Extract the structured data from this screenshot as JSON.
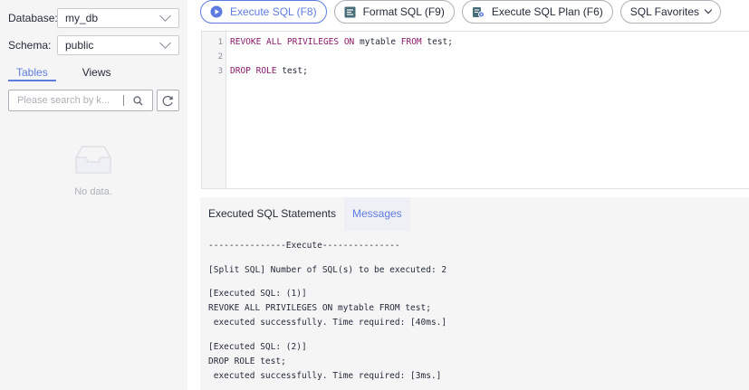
{
  "sidebar": {
    "database_label": "Database:",
    "database_value": "my_db",
    "schema_label": "Schema:",
    "schema_value": "public",
    "tabs": [
      {
        "label": "Tables",
        "active": true
      },
      {
        "label": "Views",
        "active": false
      }
    ],
    "search_placeholder": "Please search by k...",
    "empty_text": "No data."
  },
  "toolbar": {
    "execute_label": "Execute SQL (F8)",
    "format_label": "Format SQL (F9)",
    "plan_label": "Execute SQL Plan (F6)",
    "favorites_label": "SQL Favorites"
  },
  "editor": {
    "line_numbers": [
      "1",
      "2",
      "3"
    ],
    "line1": [
      {
        "text": "REVOKE ALL PRIVILEGES ON",
        "keyword": true
      },
      {
        "text": " mytable ",
        "keyword": false
      },
      {
        "text": "FROM",
        "keyword": true
      },
      {
        "text": " test;",
        "keyword": false
      }
    ],
    "line3": [
      {
        "text": "DROP ROLE",
        "keyword": true
      },
      {
        "text": " test;",
        "keyword": false
      }
    ]
  },
  "results": {
    "tabs": [
      {
        "label": "Executed SQL Statements",
        "active": false
      },
      {
        "label": "Messages",
        "active": true
      }
    ],
    "messages": {
      "header": "---------------Execute---------------",
      "split": "[Split SQL] Number of SQL(s) to be executed: 2",
      "exec1_title": "[Executed SQL: (1)]",
      "exec1_sql": "REVOKE ALL PRIVILEGES ON mytable FROM test;",
      "exec1_result": " executed successfully. Time required: [40ms.]",
      "exec2_title": "[Executed SQL: (2)]",
      "exec2_sql": "DROP ROLE test;",
      "exec2_result": " executed successfully. Time required: [3ms.]"
    }
  },
  "colors": {
    "accent": "#5e7ce0",
    "keyword": "#8b1a6b",
    "panel_bg": "#f5f5f6"
  },
  "icons": [
    "play-circle-icon",
    "format-icon",
    "plan-icon",
    "chevron-down-icon",
    "search-icon",
    "refresh-icon",
    "empty-box-icon"
  ]
}
